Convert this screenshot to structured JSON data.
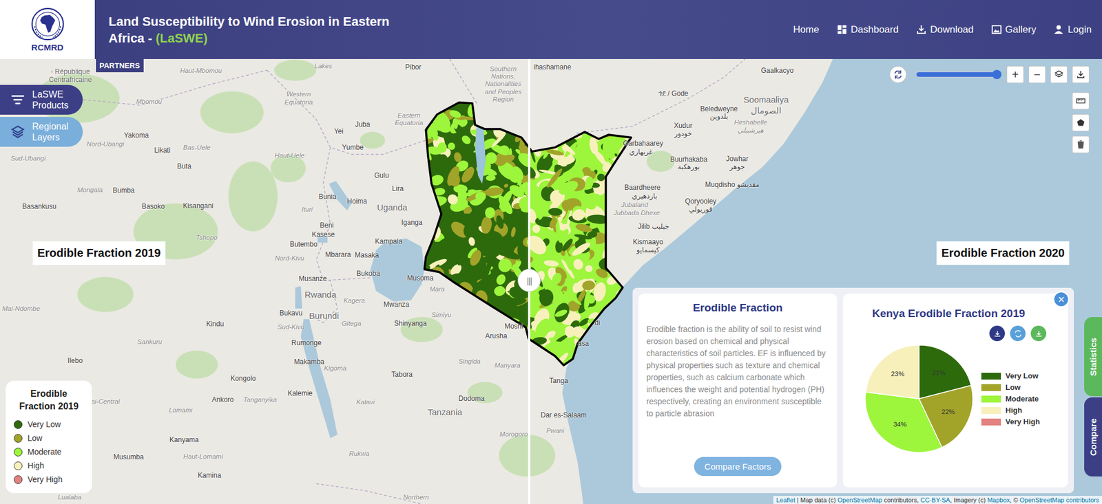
{
  "header": {
    "logo_text": "RCMRD",
    "title": "Land Susceptibility to Wind Erosion in Eastern Africa - ",
    "title_accent": "(LaSWE)",
    "nav": [
      {
        "label": "Home"
      },
      {
        "label": "Dashboard"
      },
      {
        "label": "Download"
      },
      {
        "label": "Gallery"
      },
      {
        "label": "Login"
      }
    ]
  },
  "partners_tab": "PARTNERS",
  "side_buttons": [
    {
      "label": "LaSWE Products",
      "color": "#3d3f86"
    },
    {
      "label": "Regional Layers",
      "color": "#7aaedb"
    }
  ],
  "swipe": {
    "left_label": "Erodible Fraction 2019",
    "right_label": "Erodible Fraction 2020",
    "handle": "|||"
  },
  "map_controls": {
    "opacity": {
      "level": 1
    },
    "zoom_in": "+",
    "zoom_out": "−"
  },
  "map_labels": [
    {
      "text": "- République",
      "kind": "state"
    },
    {
      "text": "Centrafricaine",
      "kind": "state"
    },
    {
      "text": "Haut-Mbomou",
      "kind": "region"
    },
    {
      "text": "Lakes",
      "kind": "region"
    },
    {
      "text": "Pibor",
      "kind": "city"
    },
    {
      "text": "Southern Nations, Nationalities and Peoples Region",
      "kind": "area"
    },
    {
      "text": "Western Equatoria",
      "kind": "area"
    },
    {
      "text": "Mbomou",
      "kind": "region"
    },
    {
      "text": "Eastern Equatoria",
      "kind": "area"
    },
    {
      "text": "Juba",
      "kind": "city"
    },
    {
      "text": "Yei",
      "kind": "city"
    },
    {
      "text": "Yakoma",
      "kind": "city"
    },
    {
      "text": "Nord-Ubangi",
      "kind": "region"
    },
    {
      "text": "Likati",
      "kind": "city"
    },
    {
      "text": "Bas-Uele",
      "kind": "region"
    },
    {
      "text": "Yumbe",
      "kind": "city"
    },
    {
      "text": "Haut-Uele",
      "kind": "region"
    },
    {
      "text": "Sud-Ubangi",
      "kind": "region"
    },
    {
      "text": "Buta",
      "kind": "city"
    },
    {
      "text": "Gulu",
      "kind": "city"
    },
    {
      "text": "Lira",
      "kind": "city"
    },
    {
      "text": "Mongala",
      "kind": "region"
    },
    {
      "text": "Bumba",
      "kind": "city"
    },
    {
      "text": "Bunia",
      "kind": "city"
    },
    {
      "text": "Hoima",
      "kind": "city"
    },
    {
      "text": "Uganda",
      "kind": "country"
    },
    {
      "text": "Basankusu",
      "kind": "city"
    },
    {
      "text": "Basoko",
      "kind": "city"
    },
    {
      "text": "Kisangani",
      "kind": "city"
    },
    {
      "text": "Ituri",
      "kind": "region"
    },
    {
      "text": "Iganga",
      "kind": "city"
    },
    {
      "text": "Beni",
      "kind": "city"
    },
    {
      "text": "Kasese",
      "kind": "city"
    },
    {
      "text": "Tshopo",
      "kind": "region"
    },
    {
      "text": "Kampala",
      "kind": "city"
    },
    {
      "text": "Butembo",
      "kind": "city"
    },
    {
      "text": "Mbarara",
      "kind": "city"
    },
    {
      "text": "Masaka",
      "kind": "city"
    },
    {
      "text": "Nord-Kivu",
      "kind": "region"
    },
    {
      "text": "Bukoba",
      "kind": "city"
    },
    {
      "text": "Musoma",
      "kind": "city"
    },
    {
      "text": "Musanze",
      "kind": "city"
    },
    {
      "text": "Mara",
      "kind": "region"
    },
    {
      "text": "Rwanda",
      "kind": "country"
    },
    {
      "text": "Kagera",
      "kind": "region"
    },
    {
      "text": "Mwanza",
      "kind": "city"
    },
    {
      "text": "Mai-Ndombe",
      "kind": "region"
    },
    {
      "text": "Bukavu",
      "kind": "city"
    },
    {
      "text": "Burundi",
      "kind": "country"
    },
    {
      "text": "Gitega",
      "kind": "region"
    },
    {
      "text": "Shinyanga",
      "kind": "city"
    },
    {
      "text": "Simiyu",
      "kind": "region"
    },
    {
      "text": "Kindu",
      "kind": "city"
    },
    {
      "text": "Sud-Kivu",
      "kind": "region"
    },
    {
      "text": "Arusha",
      "kind": "city"
    },
    {
      "text": "Moshi",
      "kind": "city"
    },
    {
      "text": "Sankuru",
      "kind": "region"
    },
    {
      "text": "Rumonge",
      "kind": "city"
    },
    {
      "text": "Ilebo",
      "kind": "city"
    },
    {
      "text": "Makamba",
      "kind": "city"
    },
    {
      "text": "Singida",
      "kind": "region"
    },
    {
      "text": "Manyara",
      "kind": "region"
    },
    {
      "text": "Kigoma",
      "kind": "region"
    },
    {
      "text": "Tabora",
      "kind": "city"
    },
    {
      "text": "Tanga",
      "kind": "city"
    },
    {
      "text": "Kongolo",
      "kind": "city"
    },
    {
      "text": "Kalemie",
      "kind": "city"
    },
    {
      "text": "Dodoma",
      "kind": "city"
    },
    {
      "text": "Ankoro",
      "kind": "city"
    },
    {
      "text": "Tanganyika",
      "kind": "region"
    },
    {
      "text": "Kasai-Central",
      "kind": "region"
    },
    {
      "text": "Katavi",
      "kind": "region"
    },
    {
      "text": "Tanzania",
      "kind": "country"
    },
    {
      "text": "Lomami",
      "kind": "region"
    },
    {
      "text": "Dar es-Salaam",
      "kind": "city"
    },
    {
      "text": "Pwani",
      "kind": "region"
    },
    {
      "text": "Morogoro",
      "kind": "region"
    },
    {
      "text": "Kanyama",
      "kind": "city"
    },
    {
      "text": "Rukwa",
      "kind": "region"
    },
    {
      "text": "Haut-Lomami",
      "kind": "region"
    },
    {
      "text": "Musumba",
      "kind": "city"
    },
    {
      "text": "Kamina",
      "kind": "city"
    },
    {
      "text": "Lualaba",
      "kind": "region"
    },
    {
      "text": "Northern",
      "kind": "region"
    },
    {
      "text": "ihashamane",
      "kind": "city"
    },
    {
      "text": "Gaalkacyo",
      "kind": "city"
    },
    {
      "text": "ጎደ / Gode",
      "kind": "city"
    },
    {
      "text": "Soomaaliya",
      "kind": "country"
    },
    {
      "text": "الصومال",
      "kind": "country"
    },
    {
      "text": "Beledweyne",
      "kind": "city"
    },
    {
      "text": "بلدوين",
      "kind": "city"
    },
    {
      "text": "Xudur",
      "kind": "city"
    },
    {
      "text": "خودور",
      "kind": "city"
    },
    {
      "text": "Hirshabelle",
      "kind": "region"
    },
    {
      "text": "هيرشبيلي",
      "kind": "region"
    },
    {
      "text": "Garbahaarey",
      "kind": "city"
    },
    {
      "text": "غربهاري",
      "kind": "city"
    },
    {
      "text": "Buurhakaba",
      "kind": "city"
    },
    {
      "text": "بورهكبة",
      "kind": "city"
    },
    {
      "text": "Jowhar",
      "kind": "city"
    },
    {
      "text": "جوهر",
      "kind": "city"
    },
    {
      "text": "Muqdisho مقديشو",
      "kind": "city"
    },
    {
      "text": "Baardheere",
      "kind": "city"
    },
    {
      "text": "باردهيري",
      "kind": "city"
    },
    {
      "text": "Qoryooley",
      "kind": "city"
    },
    {
      "text": "قوريولي",
      "kind": "city"
    },
    {
      "text": "Jubaland",
      "kind": "region"
    },
    {
      "text": "Jubbada Dhexe",
      "kind": "region"
    },
    {
      "text": "Jilib جيليب",
      "kind": "city"
    },
    {
      "text": "Kismaayo",
      "kind": "city"
    },
    {
      "text": "كيسمايو",
      "kind": "city"
    },
    {
      "text": "di",
      "kind": "city"
    },
    {
      "text": "asa",
      "kind": "city"
    }
  ],
  "legend": {
    "title": "Erodible Fraction 2019",
    "items": [
      {
        "label": "Very Low",
        "color": "#2d6a0c"
      },
      {
        "label": "Low",
        "color": "#a2a42a"
      },
      {
        "label": "Moderate",
        "color": "#9df53c"
      },
      {
        "label": "High",
        "color": "#f7f0bb"
      },
      {
        "label": "Very High",
        "color": "#e38181"
      }
    ]
  },
  "info_panel": {
    "close": "×",
    "description": {
      "title": "Erodible Fraction",
      "text": "Erodible fraction is the ability of soil to resist wind erosion based on chemical and physical characteristics of soil particles. EF is influenced by physical properties such as texture and chemical properties, such as calcium carbonate which influences the weight and potential hydrogen (PH) respectively, creating an environment susceptible to particle abrasion",
      "button": "Compare Factors"
    },
    "chart": {
      "title": "Kenya Erodible Fraction 2019",
      "series": [
        {
          "label": "Very Low",
          "value": 21,
          "value_label": "21%",
          "color": "#2d6a0c"
        },
        {
          "label": "Low",
          "value": 22,
          "value_label": "22%",
          "color": "#a2a42a"
        },
        {
          "label": "Moderate",
          "value": 34,
          "value_label": "34%",
          "color": "#9df53c"
        },
        {
          "label": "High",
          "value": 23,
          "value_label": "23%",
          "color": "#f7f0bb"
        },
        {
          "label": "Very High",
          "value": 0,
          "color": "#e38181"
        }
      ]
    }
  },
  "side_tabs": [
    {
      "label": "Statistics",
      "color": "#5cb85c"
    },
    {
      "label": "Compare",
      "color": "#3d3f86"
    }
  ],
  "attribution": [
    {
      "text": "Leaflet",
      "kind": "link"
    },
    {
      "text": " | Map data (c) ",
      "kind": "plain"
    },
    {
      "text": "OpenStreetMap",
      "kind": "link"
    },
    {
      "text": " contributors, ",
      "kind": "plain"
    },
    {
      "text": "CC-BY-SA",
      "kind": "link"
    },
    {
      "text": ", Imagery (c) ",
      "kind": "plain"
    },
    {
      "text": "Mapbox",
      "kind": "link"
    },
    {
      "text": ", © ",
      "kind": "plain"
    },
    {
      "text": "OpenStreetMap contributors",
      "kind": "link"
    }
  ]
}
